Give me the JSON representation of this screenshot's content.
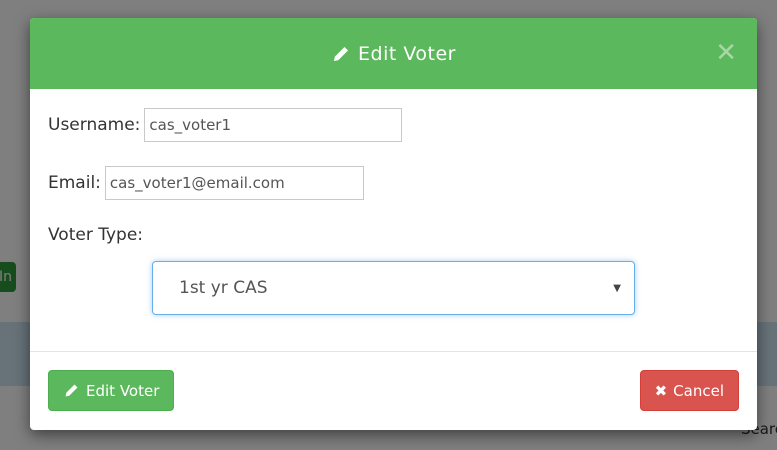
{
  "background": {
    "chip_text": "In",
    "search_text": "Searc"
  },
  "modal": {
    "title": "Edit Voter",
    "header_icon": "pencil-icon",
    "close_icon": "close-icon",
    "fields": {
      "username": {
        "label": "Username:",
        "value": "cas_voter1"
      },
      "email": {
        "label": "Email:",
        "value": "cas_voter1@email.com"
      },
      "voter_type": {
        "label": "Voter Type:",
        "selected": "1st yr CAS"
      }
    },
    "footer": {
      "edit_label": "Edit Voter",
      "cancel_label": "Cancel"
    }
  },
  "colors": {
    "header_green": "#5cb85c",
    "cancel_red": "#d9534f",
    "focus_blue": "#66afe9"
  }
}
